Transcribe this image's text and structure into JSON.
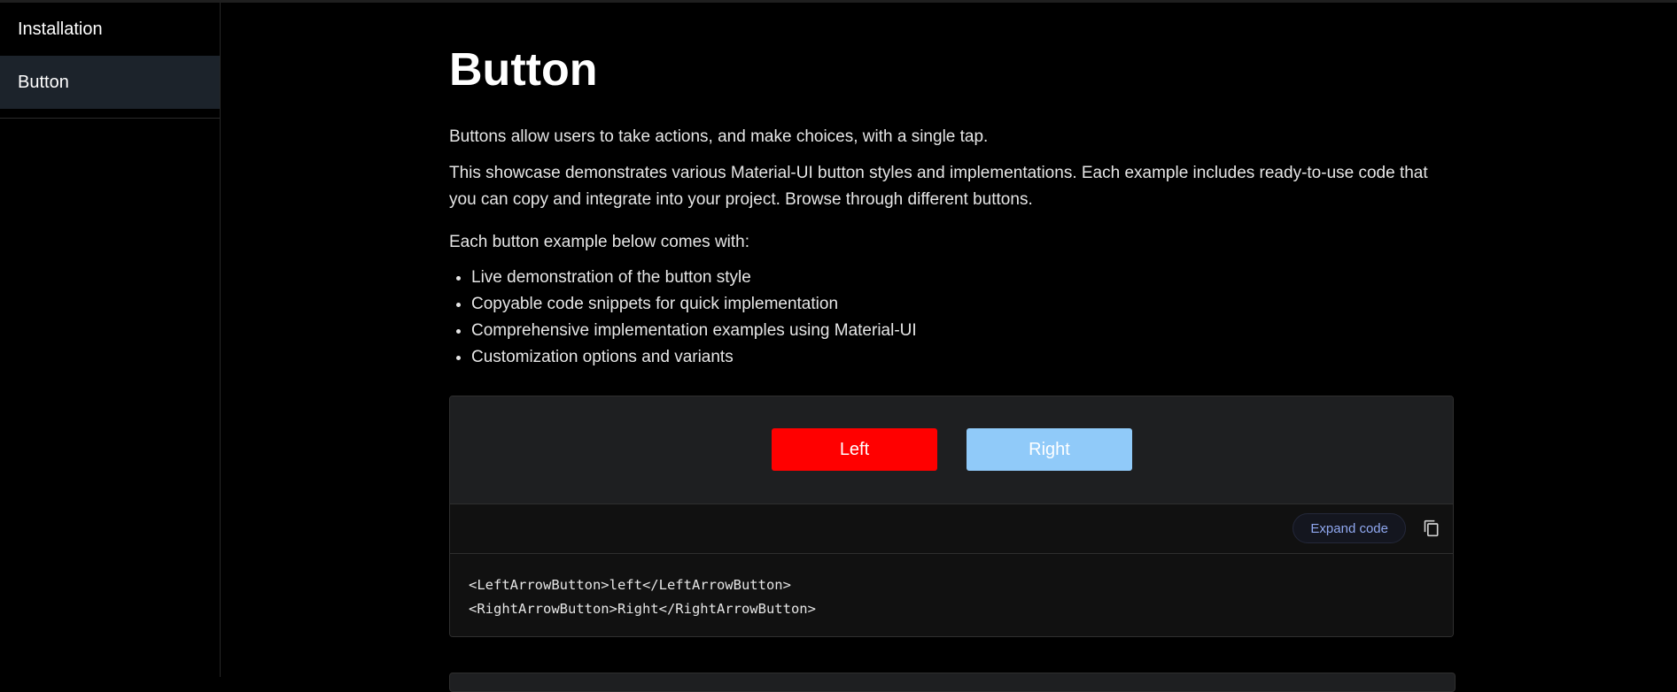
{
  "sidebar": {
    "items": [
      {
        "label": "Installation"
      },
      {
        "label": "Button"
      }
    ]
  },
  "main": {
    "title": "Button",
    "lead": "Buttons allow users to take actions, and make choices, with a single tap.",
    "description": "This showcase demonstrates various Material-UI button styles and implementations. Each example includes ready-to-use code that you can copy and integrate into your project. Browse through different buttons.",
    "list_intro": "Each button example below comes with:",
    "features": [
      "Live demonstration of the button style",
      "Copyable code snippets for quick implementation",
      "Comprehensive implementation examples using Material-UI",
      "Customization options and variants"
    ]
  },
  "demo": {
    "left_button": "Left",
    "right_button": "Right",
    "expand_label": "Expand code",
    "copy_icon": "copy-icon",
    "code_lines": [
      "<LeftArrowButton>left</LeftArrowButton>",
      "<RightArrowButton>Right</RightArrowButton>"
    ]
  },
  "colors": {
    "left_button": "#ff0000",
    "right_button": "#90caf9",
    "sidebar_active": "#1c232b",
    "expand_text": "#90a8f0"
  }
}
